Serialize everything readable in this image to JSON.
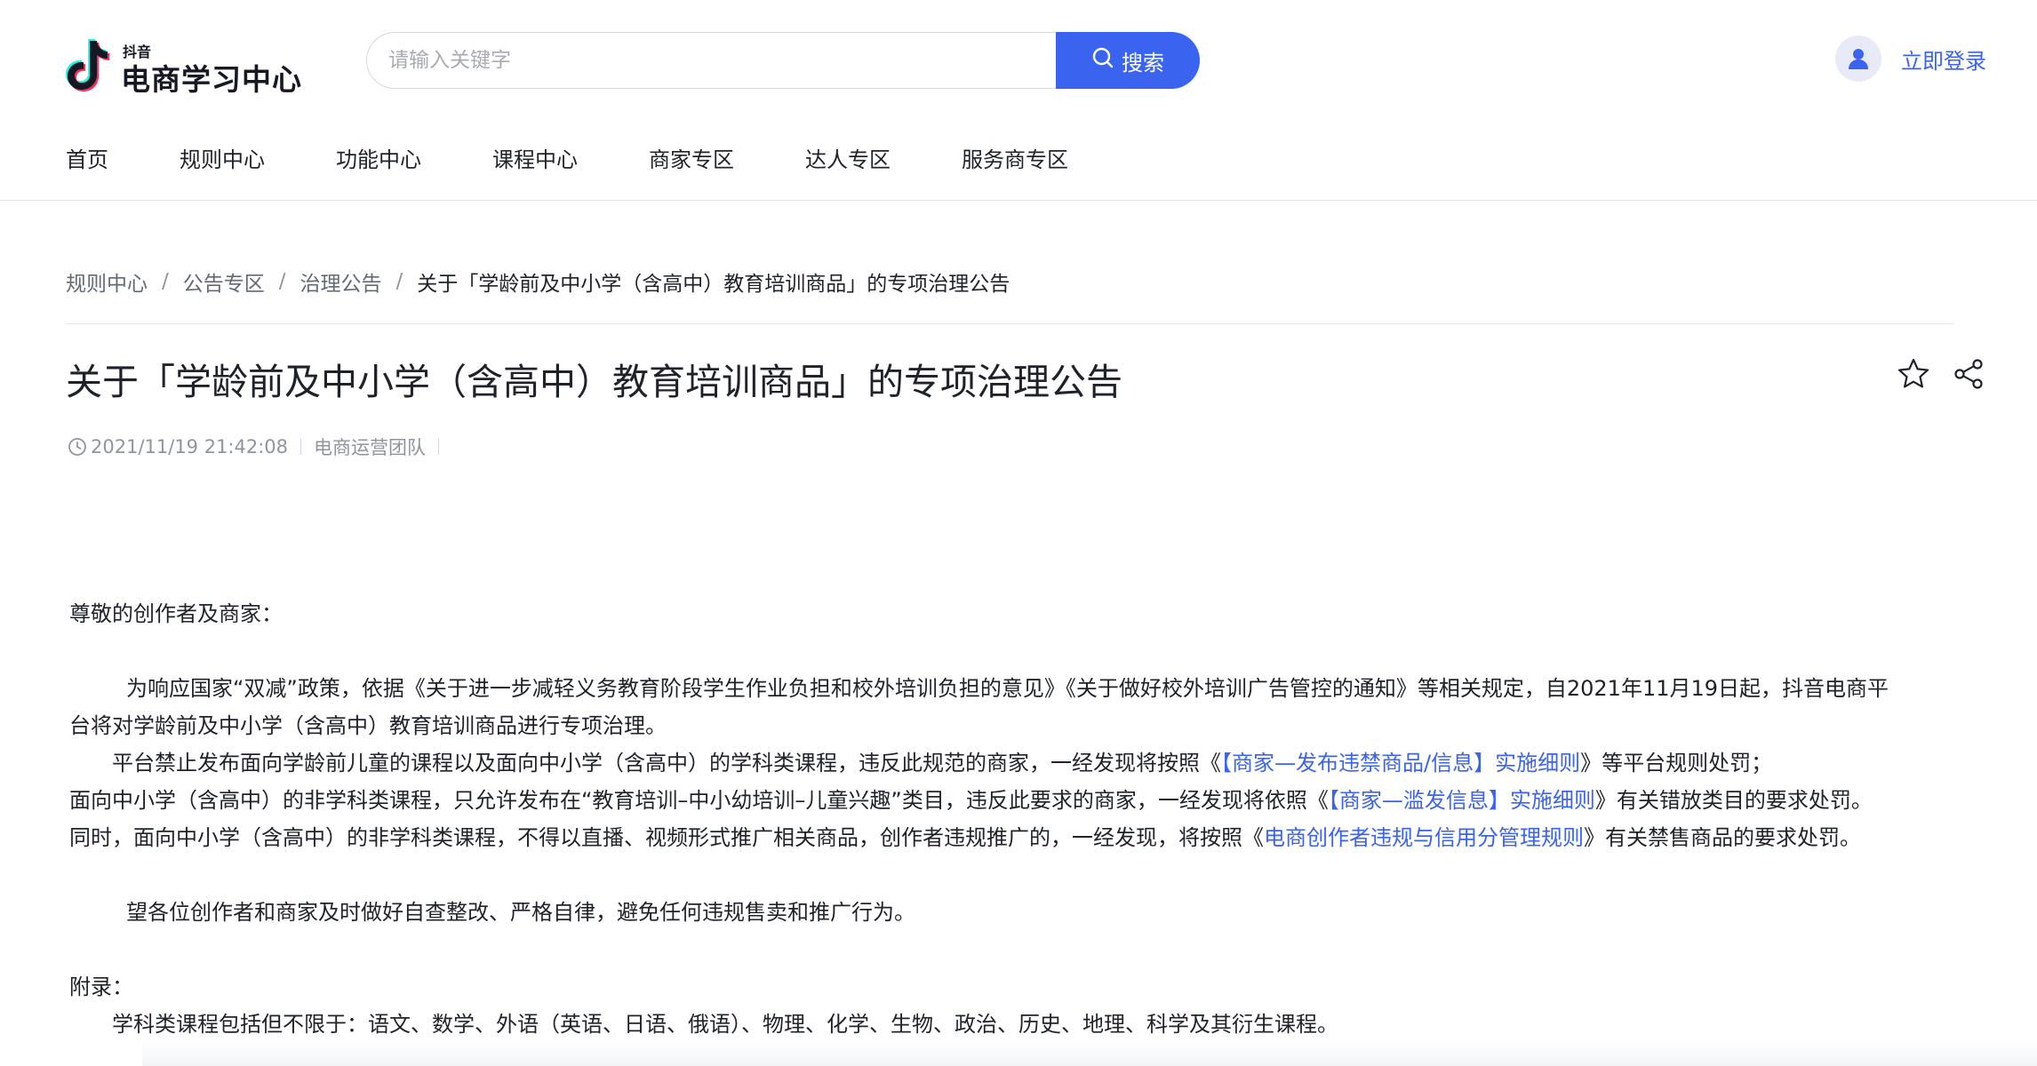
{
  "header": {
    "logo_small": "抖音",
    "logo_big": "电商学习中心",
    "search_placeholder": "请输入关键字",
    "search_button": "搜索",
    "login": "立即登录"
  },
  "nav": {
    "items": [
      "首页",
      "规则中心",
      "功能中心",
      "课程中心",
      "商家专区",
      "达人专区",
      "服务商专区"
    ]
  },
  "breadcrumb": {
    "items": [
      "规则中心",
      "公告专区",
      "治理公告",
      "关于「学龄前及中小学（含高中）教育培训商品」的专项治理公告"
    ],
    "separator": "/"
  },
  "article": {
    "title": "关于「学龄前及中小学（含高中）教育培训商品」的专项治理公告",
    "datetime": "2021/11/19 21:42:08",
    "author": "电商运营团队",
    "greeting": "尊敬的创作者及商家：",
    "para1_line1": "为响应国家“双减”政策，依据《关于进一步减轻义务教育阶段学生作业负担和校外培训负担的意见》《关于做好校外培训广告管控的通知》等相关规定，自2021年11月19日起，抖音电商平",
    "para1_line2": "台将对学龄前及中小学（含高中）教育培训商品进行专项治理。",
    "para2_a": "平台禁止发布面向学龄前儿童的课程以及面向中小学（含高中）的学科类课程，违反此规范的商家，一经发现将按照《",
    "para2_link": "【商家—发布违禁商品/信息】实施细则",
    "para2_b": "》等平台规则处罚；",
    "para3_a": "面向中小学（含高中）的非学科类课程，只允许发布在“教育培训–中小幼培训–儿童兴趣”类目，违反此要求的商家，一经发现将依照《",
    "para3_link": "【商家—滥发信息】实施细则",
    "para3_b": "》有关错放类目的要求处罚。",
    "para4_a": "同时，面向中小学（含高中）的非学科类课程，不得以直播、视频形式推广相关商品，创作者违规推广的，一经发现，将按照《",
    "para4_link": "电商创作者违规与信用分管理规则",
    "para4_b": "》有关禁售商品的要求处罚。",
    "para5": "望各位创作者和商家及时做好自查整改、严格自律，避免任何违规售卖和推广行为。",
    "appendix_label": "附录：",
    "appendix_text": "学科类课程包括但不限于：语文、数学、外语（英语、日语、俄语）、物理、化学、生物、政治、历史、地理、科学及其衍生课程。"
  },
  "colors": {
    "accent": "#3a63f0",
    "text": "#1f2329",
    "muted": "#8f959e"
  },
  "icons": [
    "douyin-logo-icon",
    "search-icon",
    "user-avatar-icon",
    "star-icon",
    "share-icon",
    "clock-icon"
  ]
}
